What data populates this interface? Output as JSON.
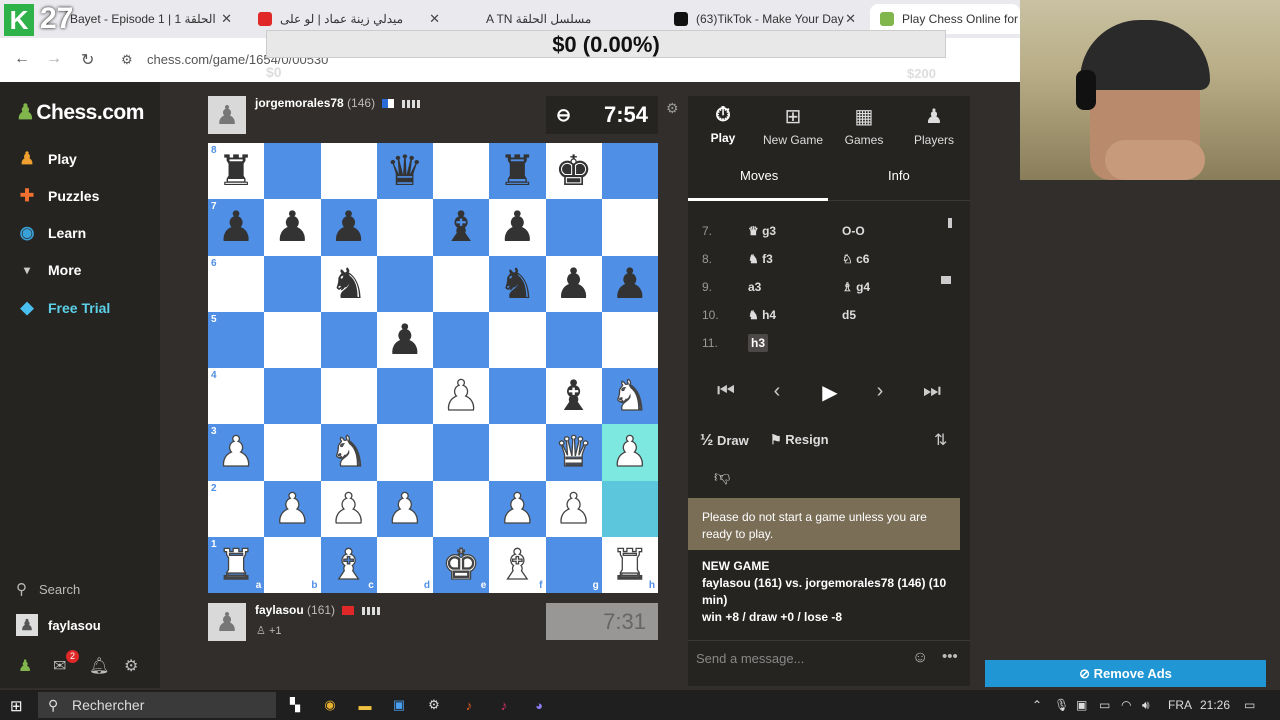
{
  "browser": {
    "tabs": [
      {
        "label": "Bayet - Episode 1 | الحلقة 1",
        "color": "#2fb24a"
      },
      {
        "label": "ميدلي زينة عماد | لو على",
        "color": "#e02828"
      },
      {
        "label": "A TN مسلسل الحلقة",
        "color": "#e02828"
      },
      {
        "label": "(63)TikTok - Make Your Day",
        "color": "#111111"
      },
      {
        "label": "Play Chess Online for FR",
        "color": "#81b64c"
      }
    ],
    "url": "chess.com/game/1654/0/00530",
    "overlay_counter": "27"
  },
  "donation": {
    "amount": "$0 (0.00%)",
    "start": "$0",
    "goal": "$200"
  },
  "sidebar": {
    "logo": "Chess.com",
    "items": [
      {
        "label": "Play",
        "icon": "play-icon"
      },
      {
        "label": "Puzzles",
        "icon": "puzzle-icon"
      },
      {
        "label": "Learn",
        "icon": "learn-icon"
      },
      {
        "label": "More",
        "icon": "chevron-down-icon"
      },
      {
        "label": "Free Trial",
        "icon": "diamond-icon"
      }
    ],
    "search": "Search",
    "username": "faylasou",
    "notification_count": "2"
  },
  "top_player": {
    "name": "jorgemorales78",
    "rating": "(146)",
    "clock": "7:54"
  },
  "bottom_player": {
    "name": "faylasou",
    "rating": "(161)",
    "clock": "7:31",
    "captured": "+1"
  },
  "board": {
    "ranks": [
      "8",
      "7",
      "6",
      "5",
      "4",
      "3",
      "2",
      "1"
    ],
    "files": [
      "a",
      "b",
      "c",
      "d",
      "e",
      "f",
      "g",
      "h"
    ],
    "position": [
      [
        "bR",
        "",
        "",
        "bQ",
        "",
        "bR",
        "bK",
        ""
      ],
      [
        "bP",
        "bP",
        "bP",
        "",
        "bB",
        "bP",
        "",
        ""
      ],
      [
        "",
        "",
        "bN",
        "",
        "",
        "bN",
        "bP",
        "bP"
      ],
      [
        "",
        "",
        "",
        "bP",
        "",
        "",
        "",
        ""
      ],
      [
        "",
        "",
        "",
        "",
        "wP",
        "",
        "bB",
        "wN"
      ],
      [
        "wP",
        "",
        "wN",
        "",
        "",
        "",
        "wQ",
        "wP"
      ],
      [
        "",
        "wP",
        "wP",
        "wP",
        "",
        "wP",
        "wP",
        ""
      ],
      [
        "wR",
        "",
        "wB",
        "",
        "wK",
        "wB",
        "",
        "wR"
      ]
    ]
  },
  "right_panel": {
    "tabs": [
      {
        "label": "Play",
        "icon": "stopwatch-icon"
      },
      {
        "label": "New Game",
        "icon": "plus-icon"
      },
      {
        "label": "Games",
        "icon": "board-icon"
      },
      {
        "label": "Players",
        "icon": "players-icon"
      }
    ],
    "subtabs": [
      "Moves",
      "Info"
    ],
    "moves": [
      {
        "n": "7.",
        "w": "♛ g3",
        "b": "O-O"
      },
      {
        "n": "8.",
        "w": "♞ f3",
        "b": "♘ c6"
      },
      {
        "n": "9.",
        "w": "a3",
        "b": "♗ g4"
      },
      {
        "n": "10.",
        "w": "♞ h4",
        "b": "d5"
      },
      {
        "n": "11.",
        "w": "h3",
        "b": ""
      }
    ],
    "draw": "Draw",
    "draw_prefix": "½",
    "resign": "Resign",
    "notice": "Please do not start a game unless you are ready to play.",
    "new_game_title": "NEW GAME",
    "new_game_players": "faylasou (161) vs. jorgemorales78 (146) (10 min)",
    "new_game_stakes": "win +8 / draw +0 / lose -8",
    "chat_placeholder": "Send a message..."
  },
  "remove_ads": "Remove Ads",
  "taskbar": {
    "search": "Rechercher",
    "lang": "FRA",
    "time": "21:26"
  },
  "colors": {
    "light_square": "#ffffff",
    "dark_square": "#4f8fe6",
    "highlight": "#7de8e0",
    "accent_green": "#81b64c",
    "remove_ads": "#2196d4"
  }
}
